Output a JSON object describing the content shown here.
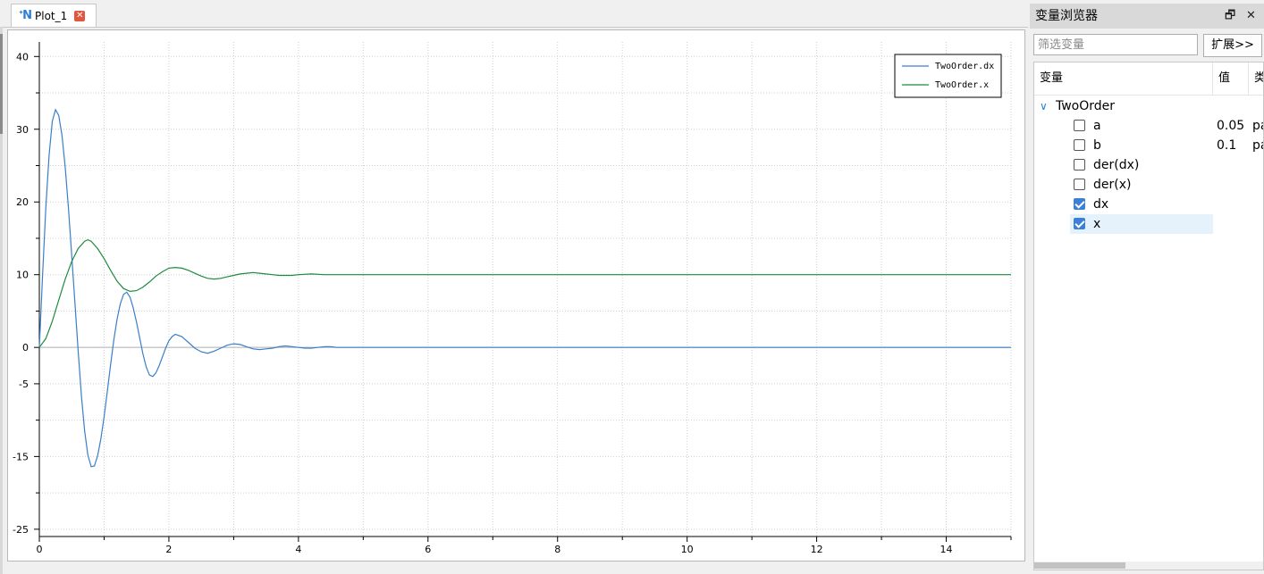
{
  "plot_tab": {
    "title": "Plot_1",
    "icon": "app-logo-icon",
    "close": "close-icon",
    "icon_glyph": "ᐩN"
  },
  "chart_data": {
    "type": "line",
    "xlim": [
      0,
      15
    ],
    "ylim": [
      -26,
      42
    ],
    "x_ticks": [
      0,
      2,
      4,
      6,
      8,
      10,
      12,
      14
    ],
    "y_ticks": [
      -25,
      -15,
      -5,
      0,
      10,
      20,
      30,
      40
    ],
    "grid": true,
    "legend_placement": "top-right",
    "series": [
      {
        "name": "TwoOrder.dx",
        "color": "#3a7fc9",
        "x": [
          0,
          0.05,
          0.1,
          0.15,
          0.2,
          0.25,
          0.3,
          0.35,
          0.4,
          0.45,
          0.5,
          0.55,
          0.6,
          0.65,
          0.7,
          0.75,
          0.8,
          0.85,
          0.9,
          0.95,
          1.0,
          1.05,
          1.1,
          1.15,
          1.2,
          1.25,
          1.3,
          1.35,
          1.4,
          1.45,
          1.5,
          1.55,
          1.6,
          1.65,
          1.7,
          1.75,
          1.8,
          1.85,
          1.9,
          1.95,
          2.0,
          2.05,
          2.1,
          2.2,
          2.3,
          2.4,
          2.5,
          2.6,
          2.7,
          2.8,
          2.9,
          3.0,
          3.1,
          3.2,
          3.3,
          3.4,
          3.5,
          3.6,
          3.7,
          3.8,
          3.9,
          4.0,
          4.1,
          4.2,
          4.3,
          4.4,
          4.5,
          4.6,
          4.7,
          4.8,
          4.9,
          5.0,
          5.2,
          5.4,
          5.6,
          5.8,
          6.0,
          6.2,
          6.4,
          6.6,
          6.8,
          7.0,
          7.5,
          8,
          9,
          10,
          11,
          12,
          13,
          14,
          15
        ],
        "y": [
          0,
          9.84,
          19.1,
          26.4,
          31.1,
          32.7,
          31.9,
          29.1,
          24.7,
          19.1,
          12.7,
          6.0,
          -0.6,
          -6.7,
          -11.5,
          -14.8,
          -16.4,
          -16.3,
          -14.9,
          -12.6,
          -9.5,
          -6.0,
          -2.4,
          1.0,
          3.9,
          6.0,
          7.3,
          7.6,
          6.9,
          5.4,
          3.5,
          1.3,
          -0.9,
          -2.7,
          -3.8,
          -4.0,
          -3.5,
          -2.5,
          -1.3,
          -0.1,
          0.9,
          1.5,
          1.8,
          1.5,
          0.7,
          -0.1,
          -0.6,
          -0.8,
          -0.5,
          -0.1,
          0.3,
          0.5,
          0.4,
          0.1,
          -0.2,
          -0.3,
          -0.2,
          -0.1,
          0.1,
          0.2,
          0.1,
          0.0,
          -0.1,
          -0.1,
          0.0,
          0.1,
          0.1,
          0.0,
          0.0,
          0.0,
          0.0,
          0,
          0,
          0,
          0,
          0,
          0,
          0,
          0,
          0,
          0,
          0,
          0,
          0,
          0,
          0,
          0,
          0,
          0,
          0,
          0
        ]
      },
      {
        "name": "TwoOrder.x",
        "color": "#1e8b3f",
        "x": [
          0,
          0.1,
          0.2,
          0.3,
          0.4,
          0.5,
          0.6,
          0.7,
          0.75,
          0.8,
          0.9,
          1.0,
          1.1,
          1.2,
          1.3,
          1.4,
          1.5,
          1.6,
          1.7,
          1.8,
          1.9,
          2.0,
          2.1,
          2.2,
          2.3,
          2.4,
          2.5,
          2.6,
          2.7,
          2.8,
          2.9,
          3.0,
          3.1,
          3.2,
          3.3,
          3.4,
          3.5,
          3.6,
          3.7,
          3.8,
          3.9,
          4.0,
          4.2,
          4.4,
          4.6,
          4.8,
          5.0,
          5.5,
          6.0,
          6.5,
          7.0,
          8,
          9,
          10,
          11,
          12,
          13,
          14,
          15
        ],
        "y": [
          0,
          1.2,
          3.6,
          6.5,
          9.4,
          11.8,
          13.6,
          14.6,
          14.8,
          14.6,
          13.6,
          12.2,
          10.6,
          9.1,
          8.1,
          7.7,
          7.8,
          8.3,
          9.0,
          9.8,
          10.4,
          10.9,
          11.0,
          10.9,
          10.6,
          10.2,
          9.8,
          9.5,
          9.4,
          9.5,
          9.7,
          9.9,
          10.1,
          10.2,
          10.3,
          10.2,
          10.1,
          10.0,
          9.9,
          9.9,
          9.9,
          10.0,
          10.1,
          10.0,
          10.0,
          10.0,
          10.0,
          10,
          10,
          10,
          10,
          10,
          10,
          10,
          10,
          10,
          10,
          10,
          10
        ]
      }
    ]
  },
  "variable_browser": {
    "title": "变量浏览器",
    "float_button": "🗗",
    "close_button": "✕",
    "filter_placeholder": "筛选变量",
    "expand_button": "扩展>>",
    "columns": {
      "variable": "变量",
      "value": "值",
      "unit": "类"
    },
    "tree": {
      "name": "TwoOrder",
      "children": [
        {
          "label": "a",
          "value": "0.05",
          "unit": "pa",
          "checked": false
        },
        {
          "label": "b",
          "value": "0.1",
          "unit": "pa",
          "checked": false
        },
        {
          "label": "der(dx)",
          "value": "",
          "unit": "",
          "checked": false
        },
        {
          "label": "der(x)",
          "value": "",
          "unit": "",
          "checked": false
        },
        {
          "label": "dx",
          "value": "",
          "unit": "",
          "checked": true
        },
        {
          "label": "x",
          "value": "",
          "unit": "",
          "checked": true
        }
      ]
    }
  }
}
